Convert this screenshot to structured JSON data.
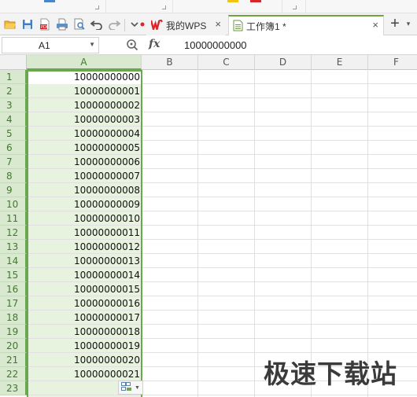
{
  "tabs": {
    "wps": {
      "label": "我的WPS",
      "close": "×"
    },
    "workbook": {
      "label": "工作簿1 *",
      "close": "×"
    },
    "add": "+",
    "menu": "▾"
  },
  "formula_bar": {
    "name_box": "A1",
    "fx": "fx",
    "content": "10000000000"
  },
  "sheet": {
    "columns": [
      "A",
      "B",
      "C",
      "D",
      "E",
      "F"
    ],
    "selected_column": "A",
    "rows": [
      "1",
      "2",
      "3",
      "4",
      "5",
      "6",
      "7",
      "8",
      "9",
      "10",
      "11",
      "12",
      "13",
      "14",
      "15",
      "16",
      "17",
      "18",
      "19",
      "20",
      "21",
      "22",
      "23"
    ],
    "column_a_values": [
      "10000000000",
      "10000000001",
      "10000000002",
      "10000000003",
      "10000000004",
      "10000000005",
      "10000000006",
      "10000000007",
      "10000000008",
      "10000000009",
      "10000000010",
      "10000000011",
      "10000000012",
      "10000000013",
      "10000000014",
      "10000000015",
      "10000000016",
      "10000000017",
      "10000000018",
      "10000000019",
      "10000000020",
      "10000000021"
    ]
  },
  "watermark": "极速下载站",
  "colors": {
    "selection_green": "#6aa84f",
    "selection_fill": "#e7f3df",
    "tab_accent": "#6fa63b",
    "wps_red": "#d9262c"
  }
}
